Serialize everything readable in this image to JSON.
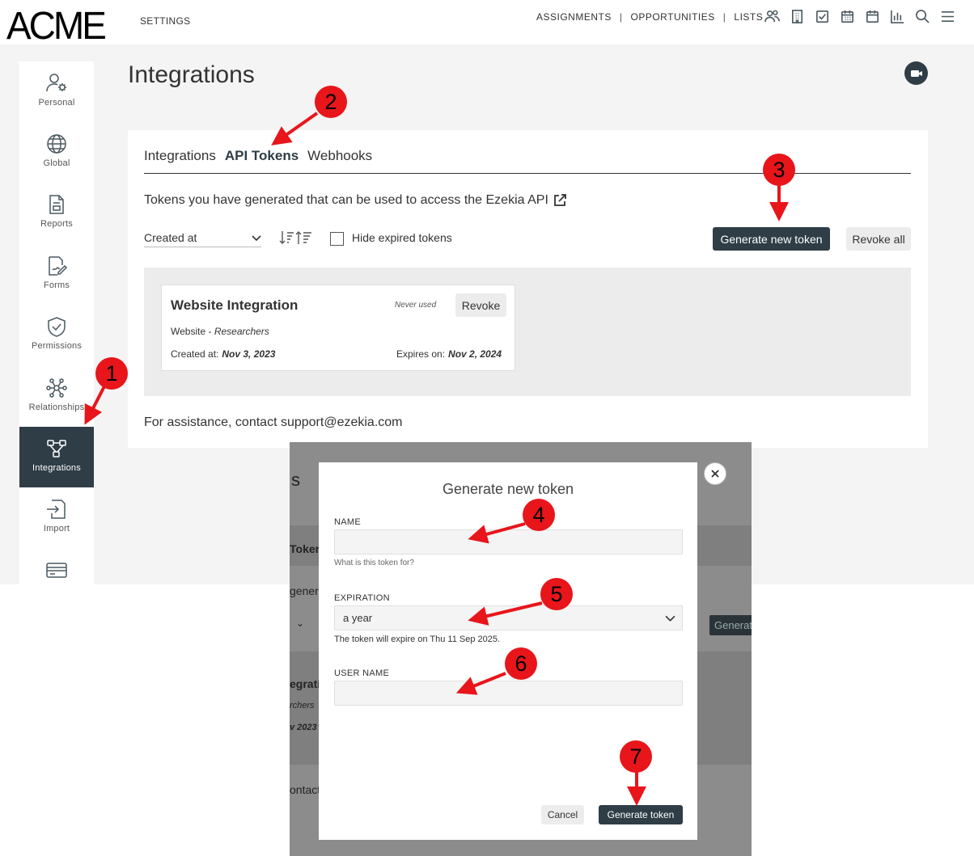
{
  "topbar": {
    "logo": "ACME",
    "section": "SETTINGS",
    "nav": [
      "ASSIGNMENTS",
      "OPPORTUNITIES",
      "LISTS"
    ],
    "icons": [
      "people-icon",
      "building-icon",
      "task-icon",
      "calendar-grid-icon",
      "calendar-icon",
      "chart-icon",
      "search-icon",
      "menu-icon"
    ]
  },
  "sidebar": {
    "items": [
      {
        "label": "Personal",
        "icon": "user-gear-icon"
      },
      {
        "label": "Global",
        "icon": "globe-icon"
      },
      {
        "label": "Reports",
        "icon": "report-icon"
      },
      {
        "label": "Forms",
        "icon": "form-icon"
      },
      {
        "label": "Permissions",
        "icon": "shield-icon"
      },
      {
        "label": "Relationships",
        "icon": "network-icon"
      },
      {
        "label": "Integrations",
        "icon": "integrations-icon",
        "active": true
      },
      {
        "label": "Import",
        "icon": "import-icon"
      },
      {
        "label": "",
        "icon": "card-icon"
      }
    ]
  },
  "page": {
    "title": "Integrations",
    "tabs": [
      "Integrations",
      "API Tokens",
      "Webhooks"
    ],
    "active_tab": "API Tokens",
    "description": "Tokens you have generated that can be used to access the Ezekia API",
    "sort_value": "Created at",
    "hide_expired_label": "Hide expired tokens",
    "generate_button": "Generate new token",
    "revoke_all_button": "Revoke all",
    "assistance": "For assistance, contact support@ezekia.com"
  },
  "token": {
    "name": "Website Integration",
    "usage": "Never used",
    "revoke": "Revoke",
    "type": "Website",
    "type_sep": " - ",
    "user": "Researchers",
    "created_label": "Created at:",
    "created": "Nov 3, 2023",
    "expires_label": "Expires on:",
    "expires": "Nov 2, 2024"
  },
  "background_fragments": {
    "heading": "s",
    "tab": "Toker",
    "desc": "gener",
    "button": "Generat",
    "token_name": "egratic",
    "token_user": "rchers",
    "token_date": "v 2023",
    "assist": "ontact"
  },
  "modal": {
    "title": "Generate new token",
    "name_label": "NAME",
    "name_value": "",
    "name_help": "What is this token for?",
    "expiration_label": "EXPIRATION",
    "expiration_value": "a year",
    "expiration_help": "The token will expire on Thu 11 Sep 2025.",
    "username_label": "USER NAME",
    "username_value": "",
    "cancel": "Cancel",
    "submit": "Generate token"
  },
  "callouts": [
    "1",
    "2",
    "3",
    "4",
    "5",
    "6",
    "7"
  ],
  "colors": {
    "primary": "#2e3d46",
    "callout": "#e8151b",
    "background": "#f4f4f4"
  }
}
